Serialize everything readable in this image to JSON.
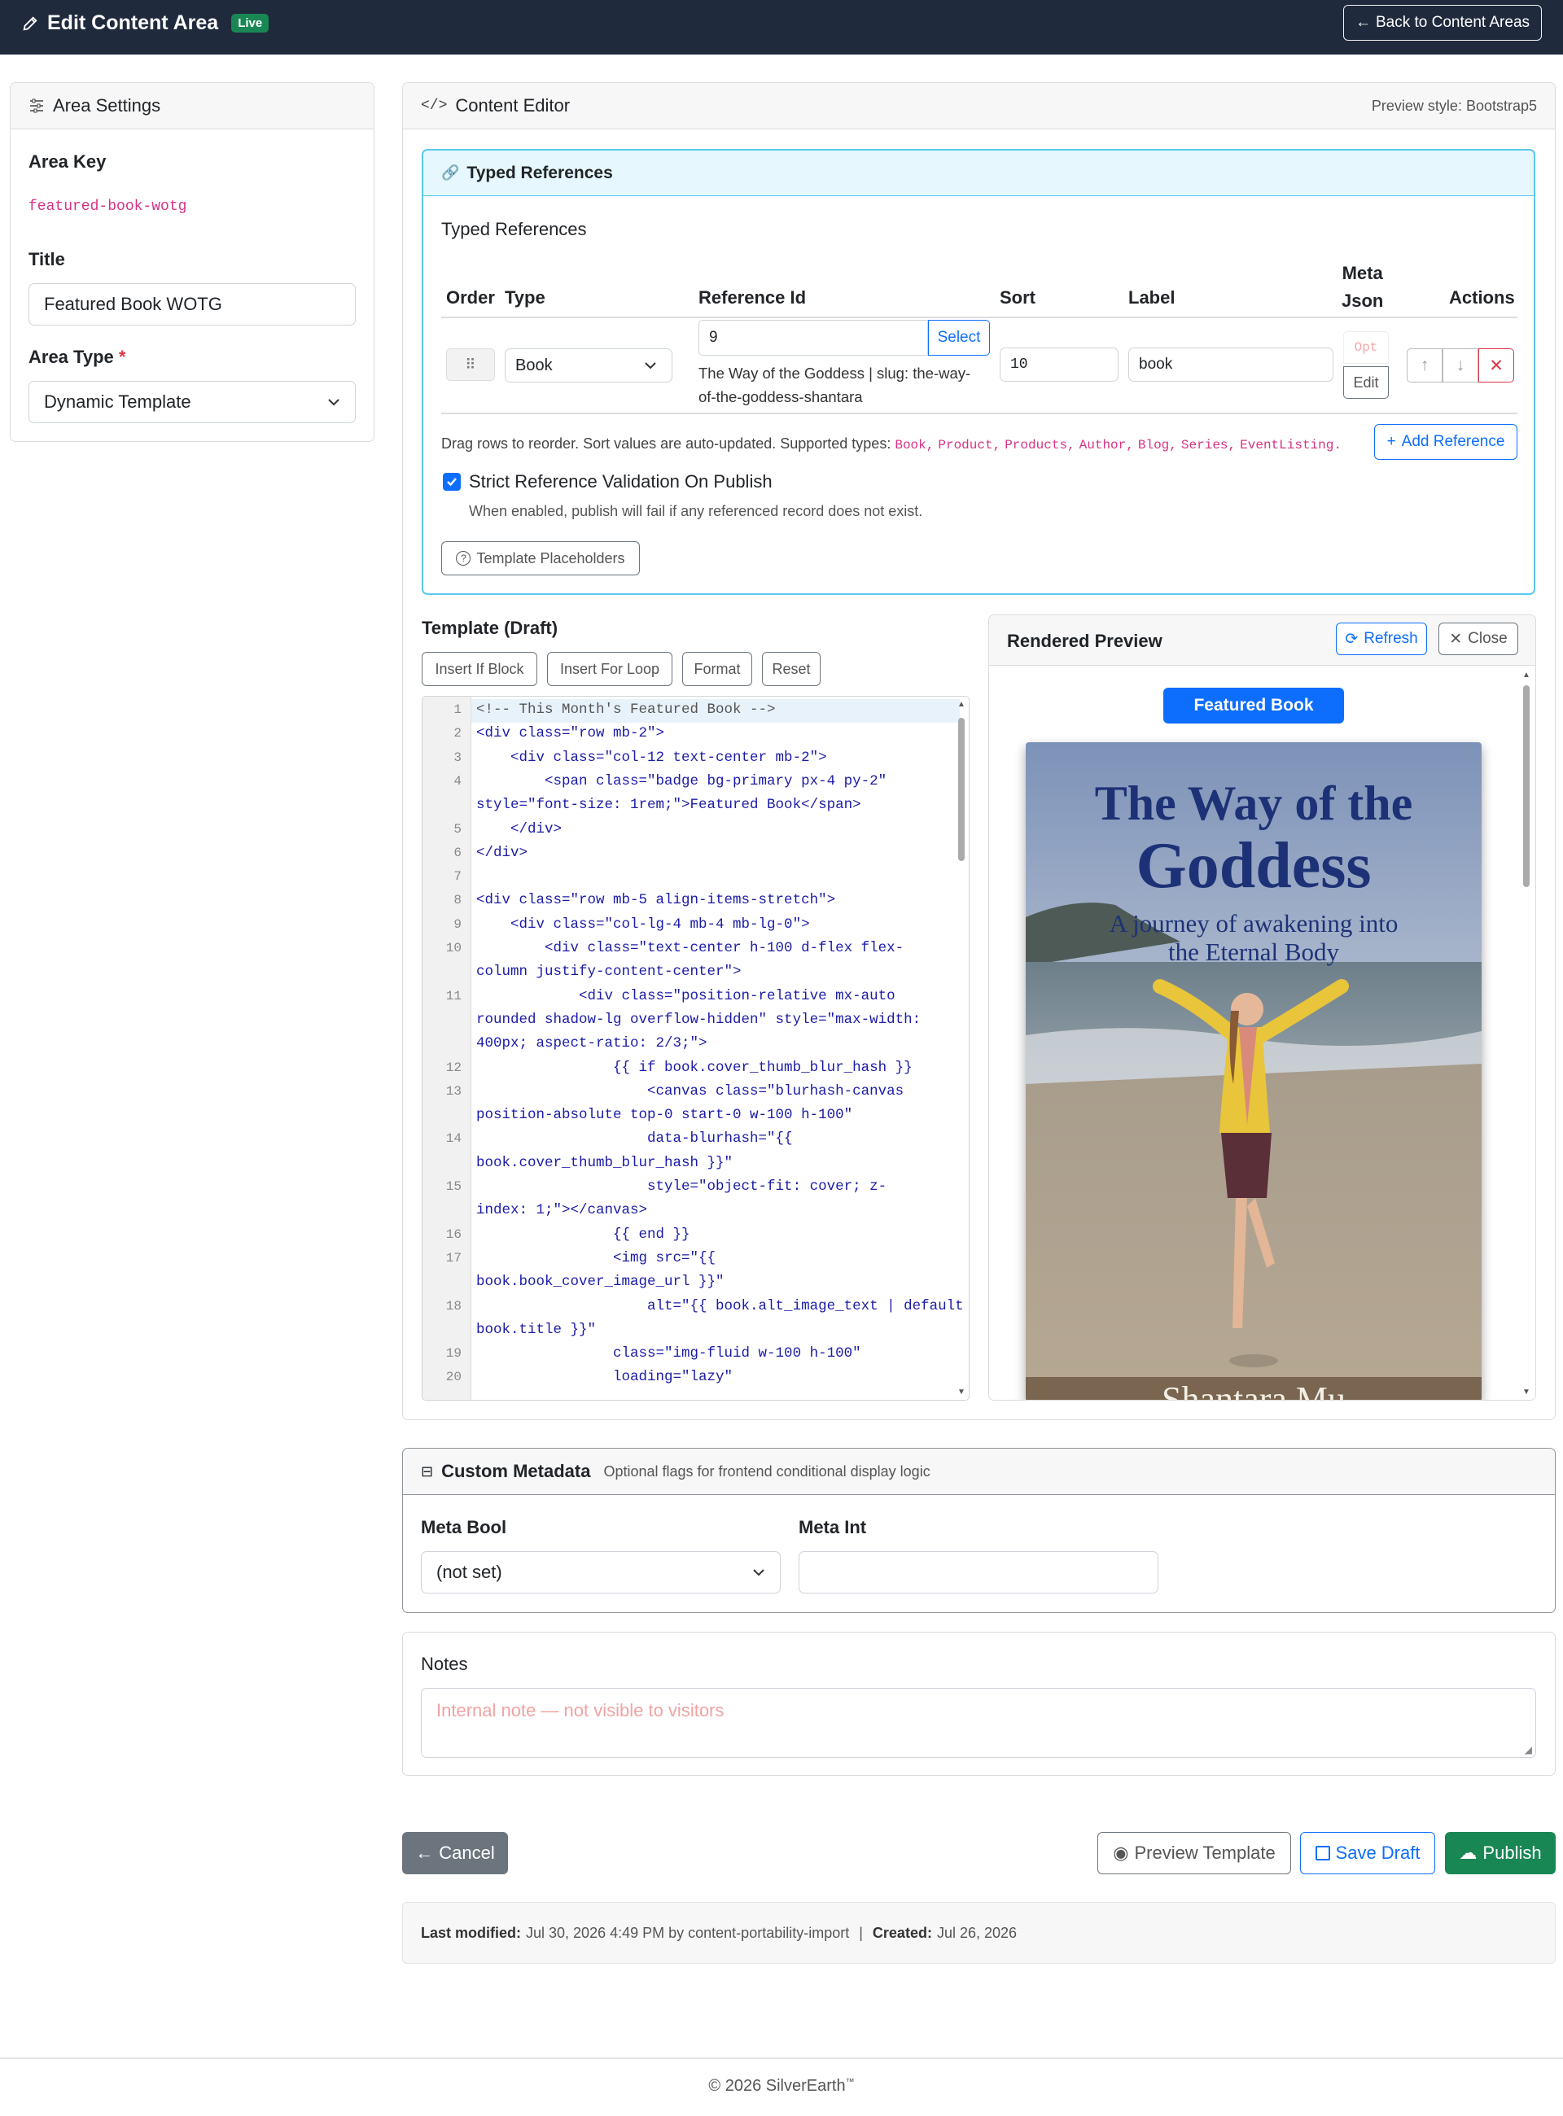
{
  "topbar": {
    "title": "Edit Content Area",
    "live_badge": "Live",
    "back_button": "Back to Content Areas"
  },
  "area_settings": {
    "header": "Area Settings",
    "area_key_label": "Area Key",
    "area_key_value": "featured-book-wotg",
    "title_label": "Title",
    "title_value": "Featured Book WOTG",
    "area_type_label": "Area Type",
    "required_mark": "*",
    "area_type_value": "Dynamic Template"
  },
  "content_editor": {
    "header": "Content Editor",
    "preview_style": "Preview style: Bootstrap5"
  },
  "typed_refs": {
    "panel_title": "Typed References",
    "section_title": "Typed References",
    "columns": {
      "order": "Order",
      "type": "Type",
      "reference_id": "Reference Id",
      "sort": "Sort",
      "label": "Label",
      "meta_json_1": "Meta",
      "meta_json_2": "Json",
      "actions": "Actions"
    },
    "row": {
      "type": "Book",
      "reference_id": "9",
      "select_button": "Select",
      "resolved_line1": "The Way of the Goddess | slug: the-way-",
      "resolved_line2": "of-the-goddess-shantara",
      "sort": "10",
      "label": "book",
      "opt_placeholder": "Opt",
      "edit_button": "Edit"
    },
    "help_text": "Drag rows to reorder. Sort values are auto-updated. Supported types:",
    "supported_types": [
      "Book,",
      "Product,",
      "Products,",
      "Author,",
      "Blog,",
      "Series,",
      "EventListing."
    ],
    "add_reference": "Add Reference",
    "strict_label": "Strict Reference Validation On Publish",
    "strict_checked": true,
    "strict_help": "When enabled, publish will fail if any referenced record does not exist.",
    "placeholders_button": "Template Placeholders"
  },
  "template": {
    "title": "Template (Draft)",
    "buttons": [
      "Insert If Block",
      "Insert For Loop",
      "Format",
      "Reset"
    ],
    "lines": [
      {
        "n": "1",
        "text": "<!-- This Month's Featured Book -->"
      },
      {
        "n": "2",
        "text": "<div class=\"row mb-2\">"
      },
      {
        "n": "3",
        "text": "    <div class=\"col-12 text-center mb-2\">"
      },
      {
        "n": "4",
        "text": "        <span class=\"badge bg-primary px-4 py-2\""
      },
      {
        "n": "",
        "text": "style=\"font-size: 1rem;\">Featured Book</span>"
      },
      {
        "n": "5",
        "text": "    </div>"
      },
      {
        "n": "6",
        "text": "</div>"
      },
      {
        "n": "7",
        "text": ""
      },
      {
        "n": "8",
        "text": "<div class=\"row mb-5 align-items-stretch\">"
      },
      {
        "n": "9",
        "text": "    <div class=\"col-lg-4 mb-4 mb-lg-0\">"
      },
      {
        "n": "10",
        "text": "        <div class=\"text-center h-100 d-flex flex-"
      },
      {
        "n": "",
        "text": "column justify-content-center\">"
      },
      {
        "n": "11",
        "text": "            <div class=\"position-relative mx-auto"
      },
      {
        "n": "",
        "text": "rounded shadow-lg overflow-hidden\" style=\"max-width:"
      },
      {
        "n": "",
        "text": "400px; aspect-ratio: 2/3;\">"
      },
      {
        "n": "12",
        "text": "                {{ if book.cover_thumb_blur_hash }}"
      },
      {
        "n": "13",
        "text": "                    <canvas class=\"blurhash-canvas"
      },
      {
        "n": "",
        "text": "position-absolute top-0 start-0 w-100 h-100\""
      },
      {
        "n": "14",
        "text": "                    data-blurhash=\"{{"
      },
      {
        "n": "",
        "text": "book.cover_thumb_blur_hash }}\""
      },
      {
        "n": "15",
        "text": "                    style=\"object-fit: cover; z-"
      },
      {
        "n": "",
        "text": "index: 1;\"></canvas>"
      },
      {
        "n": "16",
        "text": "                {{ end }}"
      },
      {
        "n": "17",
        "text": "                <img src=\"{{"
      },
      {
        "n": "",
        "text": "book.book_cover_image_url }}\""
      },
      {
        "n": "18",
        "text": "                    alt=\"{{ book.alt_image_text | default"
      },
      {
        "n": "",
        "text": "book.title }}\""
      },
      {
        "n": "19",
        "text": "                class=\"img-fluid w-100 h-100\""
      },
      {
        "n": "20",
        "text": "                loading=\"lazy\""
      }
    ]
  },
  "preview": {
    "title": "Rendered Preview",
    "refresh": "Refresh",
    "close": "Close",
    "badge": "Featured Book",
    "cover_title_1": "The Way of the",
    "cover_title_2": "Goddess",
    "cover_subtitle_1": "A journey of awakening into",
    "cover_subtitle_2": "the Eternal Body",
    "cover_author_partial": "Shantara Mu"
  },
  "custom_metadata": {
    "header": "Custom Metadata",
    "subheader": "Optional flags for frontend conditional display logic",
    "meta_bool_label": "Meta Bool",
    "meta_bool_value": "(not set)",
    "meta_int_label": "Meta Int",
    "meta_int_value": ""
  },
  "notes": {
    "label": "Notes",
    "placeholder": "Internal note — not visible to visitors"
  },
  "actions": {
    "cancel": "Cancel",
    "preview_template": "Preview Template",
    "save_draft": "Save Draft",
    "publish": "Publish"
  },
  "footer_meta": {
    "last_modified_label": "Last modified:",
    "last_modified_value": "Jul 30, 2026 4:49 PM by content-portability-import",
    "separator": "|",
    "created_label": "Created:",
    "created_value": "Jul 26, 2026"
  },
  "site_footer": {
    "copyright": "© 2026 SilverEarth",
    "tm": "™"
  },
  "colors": {
    "topbar": "#1f2a3c",
    "primary": "#0d6efd",
    "success": "#198754",
    "code_pink": "#d63384",
    "typed_ref_border": "#59c8ec",
    "typed_ref_header_bg": "#e6f7fd",
    "cancel_bg": "#6c757d"
  }
}
